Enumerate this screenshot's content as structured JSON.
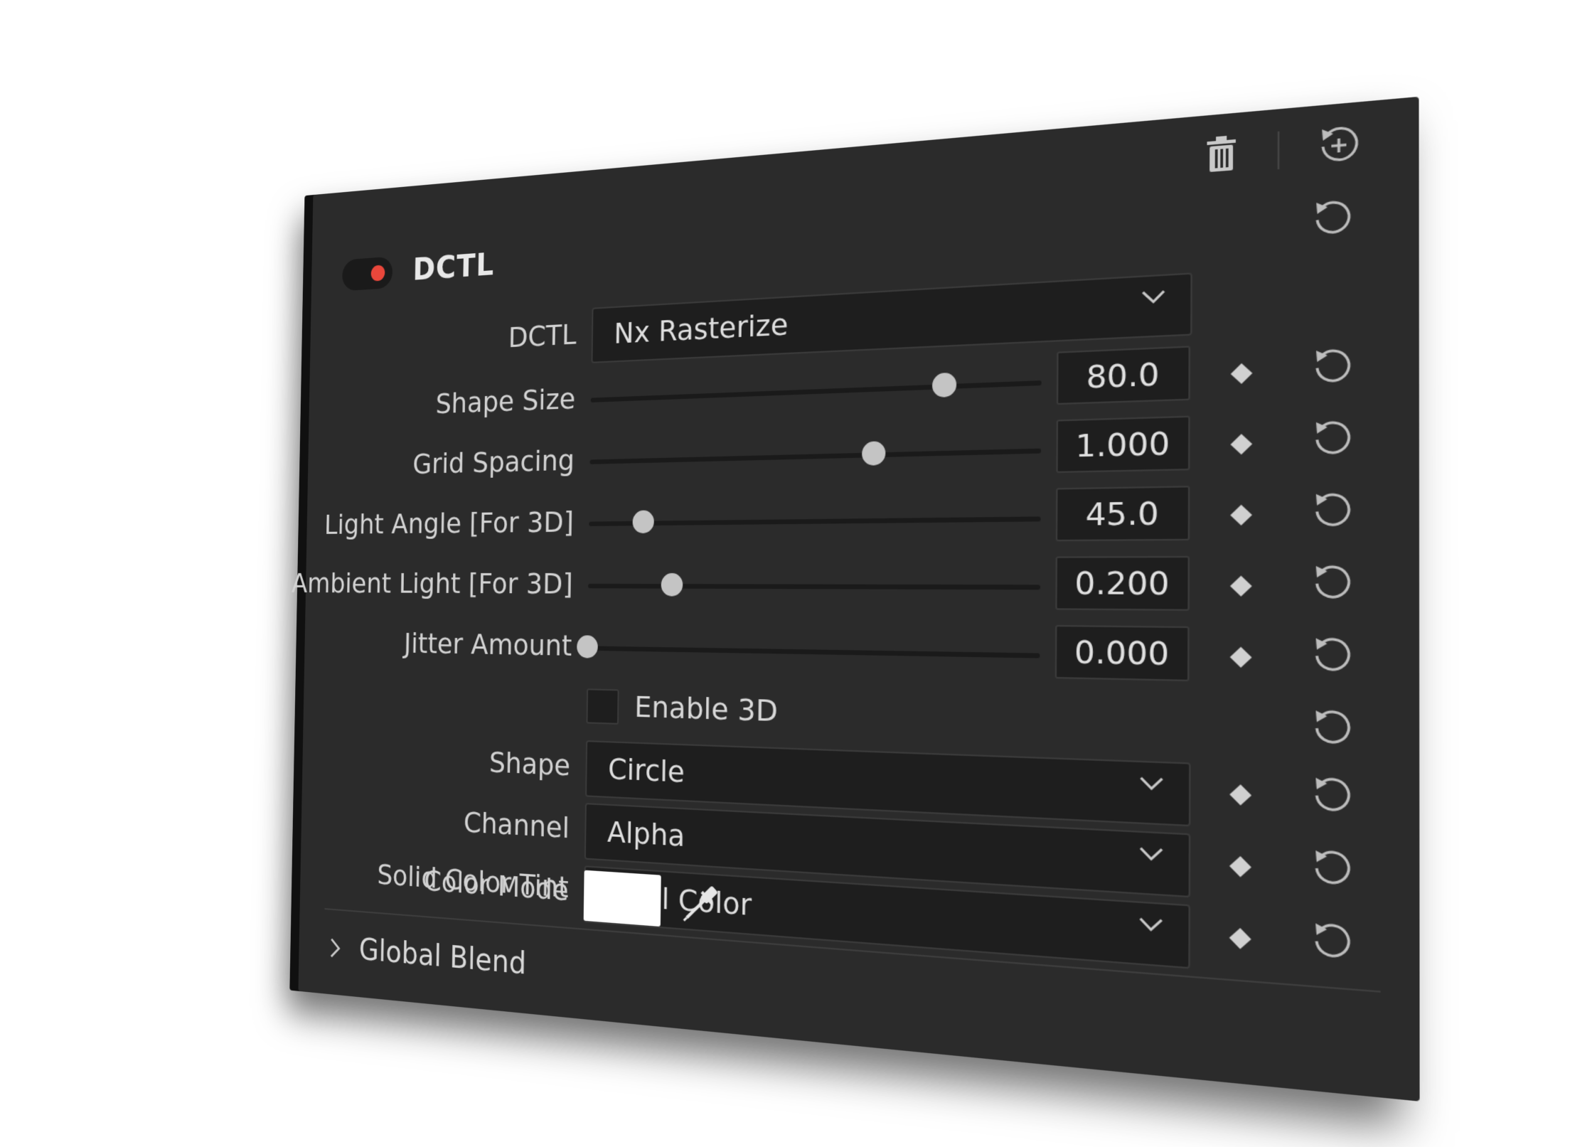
{
  "panel": {
    "title": "DCTL",
    "enabled": true,
    "colors": {
      "background": "#2b2b2b",
      "field_background": "#1e1e1e",
      "toggle_dot": "#e9473b",
      "text": "#d8d8d8",
      "swatch": "#ffffff"
    }
  },
  "dctl": {
    "label": "DCTL",
    "value": "Nx Rasterize"
  },
  "sliders": [
    {
      "label": "Shape Size",
      "value": "80.0",
      "fraction": 0.8
    },
    {
      "label": "Grid Spacing",
      "value": "1.000",
      "fraction": 0.65
    },
    {
      "label": "Light Angle [For 3D]",
      "value": "45.0",
      "fraction": 0.13
    },
    {
      "label": "Ambient Light [For 3D]",
      "value": "0.200",
      "fraction": 0.2
    },
    {
      "label": "Jitter Amount",
      "value": "0.000",
      "fraction": 0.0
    }
  ],
  "enable3d": {
    "label": "Enable 3D",
    "checked": false
  },
  "dropdowns": [
    {
      "label": "Shape",
      "value": "Circle"
    },
    {
      "label": "Channel",
      "value": "Alpha"
    },
    {
      "label": "Color Mode",
      "value": "Pixel Color"
    }
  ],
  "tint": {
    "label": "Solid Color Tint",
    "color": "#ffffff"
  },
  "global_blend": {
    "label": "Global Blend"
  },
  "icons": {
    "delete": "trash-icon",
    "reset_all": "reset-icon",
    "keyframe": "diamond-icon",
    "reset": "reset-icon",
    "eyedropper": "eyedropper-icon",
    "expand": "chevron-right-icon",
    "dropdown": "chevron-down-icon"
  }
}
